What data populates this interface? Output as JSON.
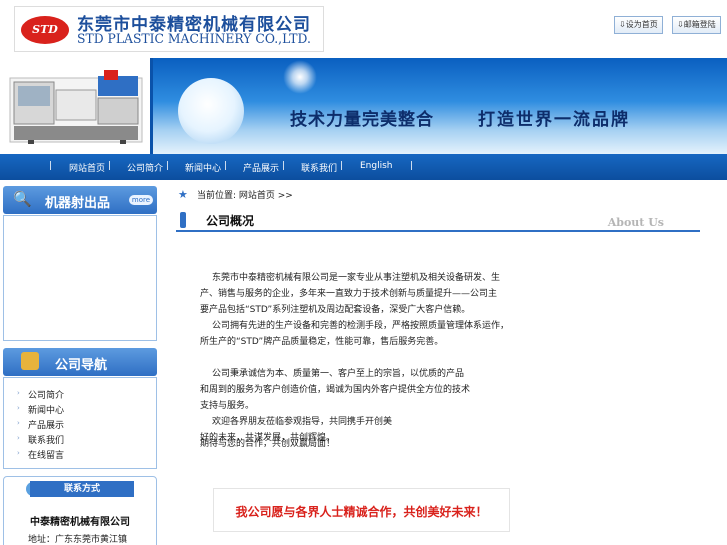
{
  "header": {
    "logo_mark": "STD",
    "company_cn": "东莞市中泰精密机械有限公司",
    "company_en": "STD PLASTIC MACHINERY CO.,LTD.",
    "glyph": "",
    "set_home_label": "设为首页",
    "mail_login_label": "邮箱登陆"
  },
  "banner": {
    "slogan_left": "技术力量完美整合",
    "slogan_right": "打造世界一流品牌",
    "glyph": ""
  },
  "nav": {
    "items": [
      "网站首页",
      "公司简介",
      "新闻中心",
      "产品展示",
      "联系我们",
      "English"
    ],
    "separator": "|"
  },
  "sidebar": {
    "products_title": "机器射出品",
    "more_label": "more",
    "glyph_left": "",
    "glyph_right": "",
    "guide_title": "公司导航",
    "guide_items": [
      "公司简介",
      "新闻中心",
      "产品展示",
      "联系我们",
      "在线留言"
    ],
    "contact_title": "联系方式",
    "contact_company": "中泰精密机械有限公司",
    "contact_address": "地址：广东东莞市黄江镇"
  },
  "main": {
    "crumb_prefix": "当前位置: 网站首页 >>",
    "crumb_current": "公司简介",
    "section_title": "公司概况",
    "section_en": "About Us",
    "glyph": "",
    "intro_line": "",
    "paragraphs": [
      "东莞市中泰精密机械有限公司是一家专业从事注塑机及相关设备研发、生产、销售与服务的企业，多年来一直致力于技术创新与质量提升——公司主要产品包括“STD”系列注塑机及周边配套设备，深受广大客户信赖。",
      "公司拥有先进的生产设备和完善的检测手段，严格按照质量管理体系运作，所生产的“STD”牌产品质量稳定，性能可靠，售后服务完善。",
      "公司秉承诚信为本、质量第一、客户至上的宗旨，以优质的产品和周到的服务为客户创造价值，竭诚为国内外客户提供全方位的技术支持与服务。",
      "欢迎各界朋友莅临参观指导，共同携手开创美好的未来，共谋发展，共创辉煌。",
      "期待与您的合作，共创双赢局面！"
    ],
    "closing": "我公司愿与各界人士精诚合作，共创美好未来！"
  },
  "colors": {
    "brand_blue": "#2f6fc4",
    "nav_blue": "#0c4e9e",
    "logo_red": "#d9221c"
  }
}
